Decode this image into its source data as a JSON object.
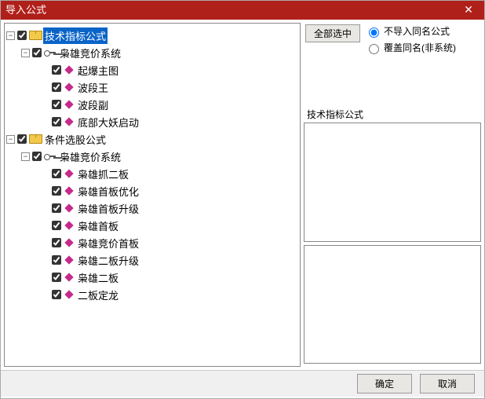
{
  "window": {
    "title": "导入公式"
  },
  "toolbar": {
    "select_all": "全部选中",
    "radio_skip": "不导入同名公式",
    "radio_override": "覆盖同名(非系统)"
  },
  "info": {
    "header": "技术指标公式"
  },
  "buttons": {
    "ok": "确定",
    "cancel": "取消"
  },
  "tree": {
    "r0": {
      "label": "技术指标公式"
    },
    "r1": {
      "label": "枭雄竞价系统"
    },
    "r2": {
      "label": "起爆主图"
    },
    "r3": {
      "label": "波段王"
    },
    "r4": {
      "label": "波段副"
    },
    "r5": {
      "label": "底部大妖启动"
    },
    "r6": {
      "label": "条件选股公式"
    },
    "r7": {
      "label": "枭雄竞价系统"
    },
    "r8": {
      "label": "枭雄抓二板"
    },
    "r9": {
      "label": "枭雄首板优化"
    },
    "r10": {
      "label": "枭雄首板升级"
    },
    "r11": {
      "label": "枭雄首板"
    },
    "r12": {
      "label": "枭雄竞价首板"
    },
    "r13": {
      "label": "枭雄二板升级"
    },
    "r14": {
      "label": "枭雄二板"
    },
    "r15": {
      "label": "二板定龙"
    }
  }
}
